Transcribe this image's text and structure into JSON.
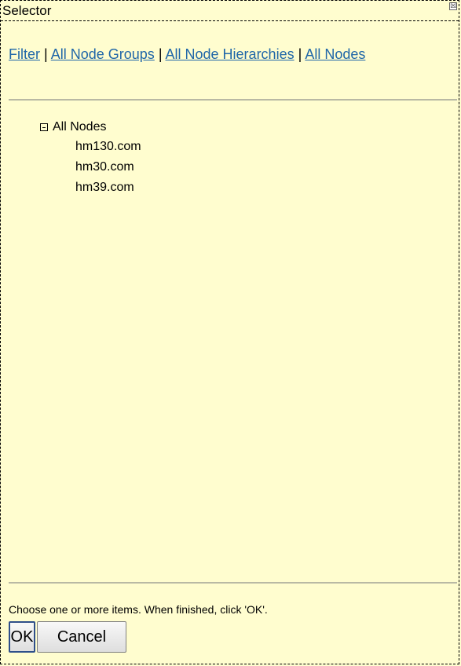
{
  "window": {
    "title": "Selector",
    "close_symbol": "☒"
  },
  "nav": {
    "links": [
      "Filter",
      "All Node Groups",
      "All Node Hierarchies",
      "All Nodes"
    ],
    "separator": "|"
  },
  "tree": {
    "root_label": "All Nodes",
    "expanded_icon": "minus-box-icon",
    "children": [
      "hm130.com",
      "hm30.com",
      "hm39.com"
    ]
  },
  "footer": {
    "instructions": "Choose one or more items. When finished, click 'OK'.",
    "ok_label": "OK",
    "cancel_label": "Cancel"
  },
  "colors": {
    "background": "#fffdcf",
    "link": "#1f66a8",
    "divider": "#b9b9a4"
  }
}
